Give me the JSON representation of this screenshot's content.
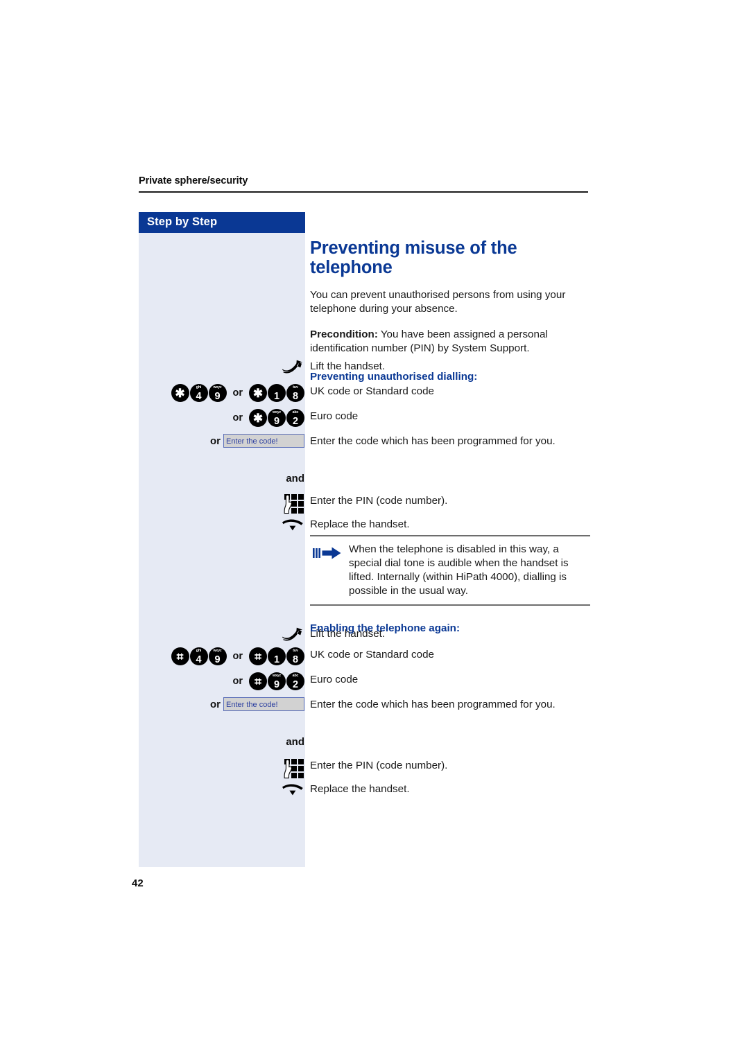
{
  "colors": {
    "brand_blue": "#0a3894",
    "sidebar_bg": "#e6eaf4",
    "display_bg": "#d2d2d2",
    "display_border": "#5b6fb8",
    "display_text": "#2b3fa0",
    "body_text": "#1a1a1a"
  },
  "running_head": "Private sphere/security",
  "sidebar": {
    "header_label": "Step by Step"
  },
  "page_number": "42",
  "main": {
    "title": "Preventing misuse of the telephone",
    "intro": "You can prevent unauthorised persons from using your telephone during your absence.",
    "precondition_label": "Precondition:",
    "precondition_text": " You have been assigned a personal identification number (PIN) by System Support.",
    "section1_heading": "Preventing unauthorised dialling:",
    "section2_heading": "Enabling the telephone again:"
  },
  "note": {
    "text": "When the telephone is disabled in this way, a special dial tone is audible when the handset is lifted. Internally (within HiPath 4000), dialling is possible in the usual way.",
    "icon": "note-arrow-icon"
  },
  "words": {
    "or": "or",
    "and": "and"
  },
  "display_field": {
    "value": "",
    "prompt": "Enter the code!"
  },
  "icons": {
    "lift_handset": "handset-lift-icon",
    "replace_handset": "handset-replace-icon",
    "keypad": "keypad-hand-icon"
  },
  "steps_section1": [
    {
      "id": "lift",
      "kind": "icon",
      "icon": "handset-lift-icon",
      "desc": "Lift the handset."
    },
    {
      "id": "uk-standard",
      "kind": "keys",
      "desc": "UK code or Standard code",
      "groups": [
        {
          "keys": [
            {
              "glyph": "*",
              "letters": ""
            },
            {
              "glyph": "4",
              "letters": "ghi"
            },
            {
              "glyph": "9",
              "letters": "wxyz"
            }
          ]
        },
        {
          "sep": "or",
          "keys": [
            {
              "glyph": "*",
              "letters": ""
            },
            {
              "glyph": "1",
              "letters": ""
            },
            {
              "glyph": "8",
              "letters": "tuv"
            }
          ]
        }
      ]
    },
    {
      "id": "euro",
      "kind": "keys",
      "desc": "Euro code",
      "groups": [
        {
          "sep": "or",
          "keys": [
            {
              "glyph": "*",
              "letters": ""
            },
            {
              "glyph": "9",
              "letters": "wxyz"
            },
            {
              "glyph": "2",
              "letters": "abc"
            }
          ]
        }
      ]
    },
    {
      "id": "code-display",
      "kind": "display",
      "lead": "or",
      "desc": "Enter the code which has been programmed for you."
    },
    {
      "id": "and-1",
      "kind": "word",
      "word": "and",
      "desc": ""
    },
    {
      "id": "pin-1",
      "kind": "icon",
      "icon": "keypad-hand-icon",
      "desc": "Enter the PIN (code number)."
    },
    {
      "id": "replace-1",
      "kind": "icon",
      "icon": "handset-replace-icon",
      "desc": "Replace the handset."
    }
  ],
  "steps_section2": [
    {
      "id": "lift-2",
      "kind": "icon",
      "icon": "handset-lift-icon",
      "desc": "Lift the handset."
    },
    {
      "id": "uk-standard-2",
      "kind": "keys",
      "desc": "UK code or Standard code",
      "groups": [
        {
          "keys": [
            {
              "glyph": "#",
              "letters": ""
            },
            {
              "glyph": "4",
              "letters": "ghi"
            },
            {
              "glyph": "9",
              "letters": "wxyz"
            }
          ]
        },
        {
          "sep": "or",
          "keys": [
            {
              "glyph": "#",
              "letters": ""
            },
            {
              "glyph": "1",
              "letters": ""
            },
            {
              "glyph": "8",
              "letters": "tuv"
            }
          ]
        }
      ]
    },
    {
      "id": "euro-2",
      "kind": "keys",
      "desc": "Euro code",
      "groups": [
        {
          "sep": "or",
          "keys": [
            {
              "glyph": "#",
              "letters": ""
            },
            {
              "glyph": "9",
              "letters": "wxyz"
            },
            {
              "glyph": "2",
              "letters": "abc"
            }
          ]
        }
      ]
    },
    {
      "id": "code-display-2",
      "kind": "display",
      "lead": "or",
      "desc": "Enter the code which has been programmed for you."
    },
    {
      "id": "and-2",
      "kind": "word",
      "word": "and",
      "desc": ""
    },
    {
      "id": "pin-2",
      "kind": "icon",
      "icon": "keypad-hand-icon",
      "desc": "Enter the PIN (code number)."
    },
    {
      "id": "replace-2",
      "kind": "icon",
      "icon": "handset-replace-icon",
      "desc": "Replace the handset."
    }
  ]
}
